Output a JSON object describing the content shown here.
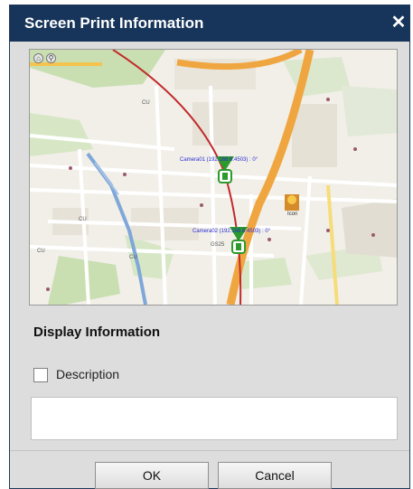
{
  "dialog": {
    "title": "Screen Print Information",
    "close_glyph": "✕"
  },
  "map": {
    "tools": [
      {
        "icon": "home-icon",
        "glyph": "⌂"
      },
      {
        "icon": "zoom-icon",
        "glyph": "⚲"
      }
    ],
    "camera1_label": "Camera01 (192.168.6.4503) : 0°",
    "camera2_label": "Camera02 (192.168.6.4503) : 0°",
    "place_labels": [
      "CU",
      "CU",
      "CU",
      "CU",
      "GS25",
      "Icon"
    ]
  },
  "display_information": {
    "title": "Display Information",
    "description_label": "Description",
    "description_checked": false,
    "description_value": ""
  },
  "buttons": {
    "ok": "OK",
    "cancel": "Cancel"
  }
}
